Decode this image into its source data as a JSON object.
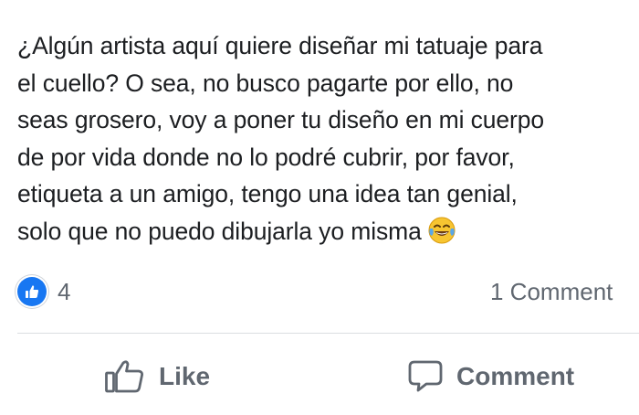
{
  "post": {
    "text_lines": [
      "¿Algún artista aquí quiere diseñar mi tatuaje para",
      "el cuello? O sea, no busco pagarte por ello, no",
      "seas grosero, voy a poner tu diseño en mi cuerpo",
      "de por vida donde no lo podré cubrir, por favor,",
      "etiqueta a un amigo, tengo una idea tan genial,",
      "solo que no puedo dibujarla yo misma"
    ],
    "emoji_icon": "tears-of-joy-emoji"
  },
  "reactions": {
    "icon": "like-reaction-icon",
    "count": "4",
    "color": "#1877f2"
  },
  "comments": {
    "count_label": "1 Comment"
  },
  "actions": {
    "like_label": "Like",
    "like_icon": "thumbs-up-outline-icon",
    "comment_label": "Comment",
    "comment_icon": "speech-bubble-icon"
  }
}
